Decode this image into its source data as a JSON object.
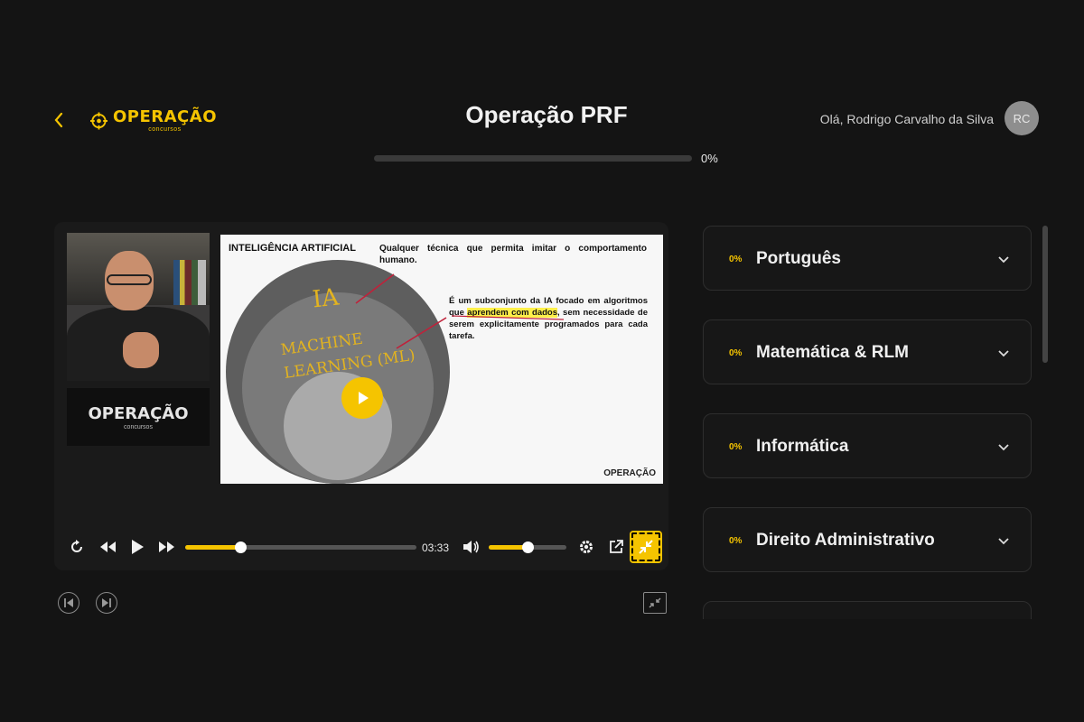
{
  "header": {
    "logo_text": "OPERAÇÃO",
    "logo_sub": "concursos",
    "title": "Operação PRF",
    "greeting": "Olá, Rodrigo Carvalho da Silva",
    "avatar_initials": "RC",
    "progress_percent": 0,
    "progress_label": "0%"
  },
  "video": {
    "brand_card_text": "OPERAÇÃO",
    "brand_card_sub": "concursos",
    "slide": {
      "title": "INTELIGÊNCIA ARTIFICIAL",
      "text1": "Qualquer técnica que permita imitar o comportamento humano.",
      "text2_pre": "É um subconjunto da IA focado em algoritmos que",
      "text2_hl": "aprendem com dados",
      "text2_post": ", sem necessidade de serem explicitamente programados para cada tarefa.",
      "handwriting_ia": "IA",
      "handwriting_ml": "MACHINE LEARNING (ML)",
      "brand": "OPERAÇÃO"
    },
    "controls": {
      "current_time": "03:33",
      "seek_fraction": 0.24,
      "volume_fraction": 0.5
    }
  },
  "courses": [
    {
      "percent": "0%",
      "name": "Português"
    },
    {
      "percent": "0%",
      "name": "Matemática & RLM"
    },
    {
      "percent": "0%",
      "name": "Informática"
    },
    {
      "percent": "0%",
      "name": "Direito Administrativo"
    },
    {
      "percent": "",
      "name": ""
    }
  ],
  "colors": {
    "accent": "#f5c400",
    "background": "#141414",
    "card_border": "#2e2e2e"
  },
  "icons": [
    "chevron-left-icon",
    "replay-icon",
    "rewind-icon",
    "play-icon",
    "forward-icon",
    "volume-icon",
    "gear-icon",
    "external-link-icon",
    "fullscreen-exit-icon",
    "skip-previous-icon",
    "skip-next-icon",
    "minimize-icon",
    "chevron-down-icon"
  ]
}
